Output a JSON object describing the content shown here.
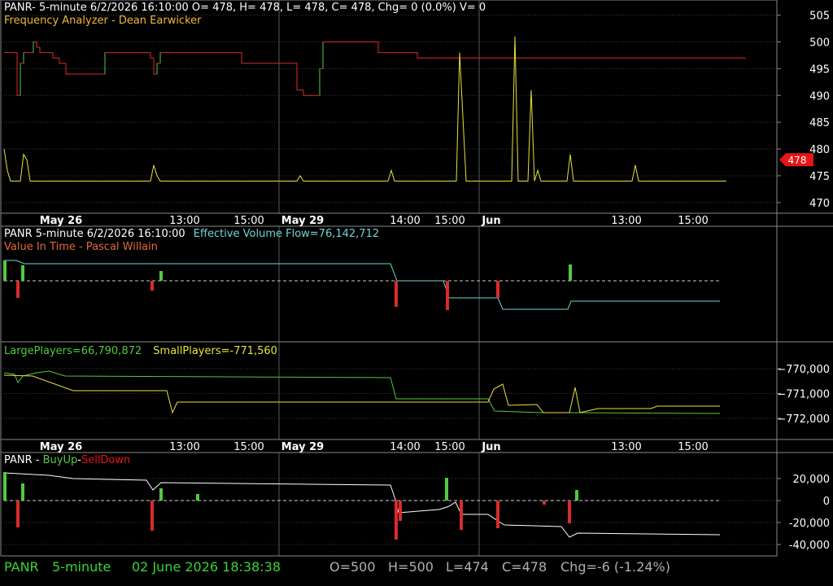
{
  "colors": {
    "bg": "#000000",
    "grid": "#3a3a3a",
    "axis": "#8a8a8a",
    "text": "#ffffff",
    "yellow": "#e7e23c",
    "orange": "#f2b83a",
    "red": "#d82b2b",
    "green": "#4fcb3f",
    "cyan": "#6fd6d6",
    "white": "#ffffff",
    "price_tag": "#e81515",
    "status_green": "#35d435",
    "status_gray": "#b0b0b0"
  },
  "panel1": {
    "title": "PANR- 5-minute 6/2/2026 16:10:00 O= 478, H= 478, L= 478, C= 478, Chg= 0 (0.0%) V= 0",
    "subtitle": "Frequency Analyzer - Dean Earwicker",
    "price_tag": "478"
  },
  "panel2": {
    "title": "PANR 5-minute  6/2/2026 16:10:00",
    "subtitle": "Effective Volume Flow=76,142,712",
    "line2": "Value In Time - Pascal Willain"
  },
  "panel3": {
    "large": "LargePlayers=66,790,872",
    "small": "SmallPlayers=-771,560"
  },
  "panel4": {
    "prefix": "PANR - ",
    "buy": "BuyUp",
    "sep": "-",
    "sell": "SellDown"
  },
  "status": {
    "symbol": "PANR",
    "interval": "5-minute",
    "datetime": "02 June 2026 18:38:38",
    "o": "O=500",
    "h": "H=500",
    "l": "L=474",
    "c": "C=478",
    "chg": "Chg=-6 (-1.24%)"
  },
  "chart_data": [
    {
      "type": "line",
      "panel": "price",
      "x_tick_labels": [
        "May 26",
        "13:00",
        "15:00",
        "May 29",
        "14:00",
        "15:00",
        "Jun",
        "13:00",
        "15:00"
      ],
      "y_ticks": [
        470,
        475,
        480,
        485,
        490,
        495,
        500,
        505
      ],
      "ylim": [
        468,
        506
      ],
      "last_value": 478,
      "x": [
        0,
        1,
        2,
        3,
        4,
        5,
        6,
        7,
        8,
        9,
        10,
        11,
        12,
        13,
        14,
        15,
        16,
        17,
        18,
        19,
        20,
        21,
        22,
        23,
        24,
        25,
        26,
        27,
        28,
        29,
        30,
        31,
        32,
        33,
        34,
        35,
        36,
        37,
        38,
        39,
        40,
        41,
        42,
        43,
        44,
        45,
        46,
        47,
        48,
        49,
        50,
        51,
        52,
        53,
        54,
        55,
        56,
        57,
        58,
        59,
        60,
        61,
        62,
        63,
        64,
        65,
        66,
        67,
        68,
        69,
        70,
        71,
        72,
        73,
        74,
        75,
        76,
        77,
        78,
        79,
        80,
        81,
        82,
        83,
        84,
        85,
        86,
        87,
        88,
        89,
        90,
        91,
        92,
        93,
        94,
        95,
        96,
        97,
        98,
        99,
        100,
        101,
        102,
        103,
        104,
        105,
        106,
        107,
        108,
        109,
        110,
        111,
        112,
        113,
        114,
        115,
        116,
        117,
        118,
        119,
        120,
        121,
        122,
        123,
        124,
        125,
        126,
        127,
        128,
        129,
        130,
        131,
        132,
        133,
        134,
        135,
        136,
        137,
        138,
        139,
        140,
        141,
        142,
        143,
        144,
        145,
        146,
        147,
        148,
        149,
        150,
        151,
        152,
        153,
        154,
        155,
        156,
        157,
        158,
        159,
        160,
        161,
        162,
        163,
        164,
        165,
        166,
        167,
        168,
        169,
        170,
        171,
        172,
        173,
        174,
        175,
        176,
        177,
        178,
        179,
        180,
        181,
        182,
        183,
        184,
        185,
        186,
        187,
        188,
        189,
        190,
        191,
        192,
        193,
        194,
        195,
        196,
        197,
        198,
        199,
        200,
        201,
        202,
        203,
        204,
        205,
        206,
        207,
        208,
        209,
        210,
        211,
        212,
        213,
        214,
        215,
        216,
        217,
        218,
        219,
        220
      ],
      "series": [
        {
          "color": "mixed-step",
          "values": [
            498,
            498,
            498,
            498,
            490,
            496,
            498,
            498,
            498,
            500,
            499,
            498,
            498,
            498,
            498,
            497,
            497,
            496,
            496,
            494,
            494,
            494,
            494,
            494,
            494,
            494,
            494,
            494,
            494,
            494,
            494,
            498,
            498,
            498,
            498,
            498,
            498,
            498,
            498,
            498,
            498,
            498,
            498,
            498,
            498,
            497,
            494,
            496,
            498,
            498,
            498,
            498,
            498,
            498,
            498,
            498,
            498,
            498,
            498,
            498,
            498,
            498,
            498,
            498,
            498,
            498,
            498,
            498,
            498,
            498,
            498,
            498,
            498,
            496,
            496,
            496,
            496,
            496,
            496,
            496,
            496,
            496,
            496,
            496,
            496,
            496,
            496,
            496,
            496,
            496,
            491,
            491,
            490,
            490,
            490,
            490,
            490,
            495,
            500,
            500,
            500,
            500,
            500,
            500,
            500,
            500,
            500,
            500,
            500,
            500,
            500,
            500,
            500,
            500,
            500,
            498,
            498,
            498,
            498,
            498,
            498,
            498,
            498,
            498,
            498,
            498,
            498,
            497,
            497,
            497,
            497,
            497,
            497,
            497,
            497,
            497,
            497,
            497,
            497,
            497,
            497,
            497,
            497,
            497,
            497,
            497,
            497,
            497,
            497,
            497,
            497,
            497,
            497,
            497,
            497,
            497,
            497,
            497,
            497,
            497,
            497,
            497,
            497,
            497,
            497,
            497,
            497,
            497,
            497,
            497,
            497,
            497,
            497,
            497,
            497,
            497,
            497,
            497,
            497,
            497,
            497,
            497,
            497,
            497,
            497,
            497,
            497,
            497,
            497,
            497,
            497,
            497,
            497,
            497,
            497,
            497,
            497,
            497,
            497,
            497,
            497,
            497,
            497,
            497,
            497,
            497,
            497,
            497,
            497,
            497,
            497,
            497,
            497,
            497,
            497,
            497,
            497,
            497,
            497,
            497,
            497,
            497,
            497,
            497,
            497,
            497,
            497,
            497,
            497
          ]
        },
        {
          "color": "yellow",
          "values": [
            480,
            476,
            474,
            474,
            474,
            474,
            479,
            478,
            474,
            474,
            474,
            474,
            474,
            474,
            474,
            474,
            474,
            474,
            474,
            474,
            474,
            474,
            474,
            474,
            474,
            474,
            474,
            474,
            474,
            474,
            474,
            474,
            474,
            474,
            474,
            474,
            474,
            474,
            474,
            474,
            474,
            474,
            474,
            474,
            474,
            474,
            477,
            475,
            474,
            474,
            474,
            474,
            474,
            474,
            474,
            474,
            474,
            474,
            474,
            474,
            474,
            474,
            474,
            474,
            474,
            474,
            474,
            474,
            474,
            474,
            474,
            474,
            474,
            474,
            474,
            474,
            474,
            474,
            474,
            474,
            474,
            474,
            474,
            474,
            474,
            474,
            474,
            474,
            474,
            474,
            474,
            475,
            474,
            474,
            474,
            474,
            474,
            474,
            474,
            474,
            474,
            474,
            474,
            474,
            474,
            474,
            474,
            474,
            474,
            474,
            474,
            474,
            474,
            474,
            474,
            474,
            474,
            474,
            474,
            476,
            474,
            474,
            474,
            474,
            474,
            474,
            474,
            474,
            474,
            474,
            474,
            474,
            474,
            474,
            474,
            474,
            474,
            474,
            474,
            474,
            498,
            486,
            474,
            474,
            474,
            474,
            474,
            474,
            474,
            474,
            474,
            474,
            474,
            474,
            474,
            474,
            474,
            501,
            474,
            474,
            474,
            474,
            491,
            474,
            476,
            474,
            474,
            474,
            474,
            474,
            474,
            474,
            474,
            474,
            479,
            474,
            474,
            474,
            474,
            474,
            474,
            474,
            474,
            474,
            474,
            474,
            474,
            474,
            474,
            474,
            474,
            474,
            474,
            474,
            477,
            474,
            474,
            474,
            474,
            474,
            474,
            474,
            474,
            474,
            474,
            474,
            474,
            474,
            474,
            474,
            474,
            474,
            474,
            474,
            474,
            474,
            474,
            474,
            474,
            474,
            474,
            474,
            474
          ]
        }
      ]
    },
    {
      "type": "line",
      "panel": "effective-volume-flow",
      "series": [
        {
          "name": "Effective Volume Flow",
          "color": "cyan"
        }
      ]
    },
    {
      "type": "line",
      "panel": "players",
      "y_ticks": [
        -770000,
        -771000,
        -772000
      ],
      "y_tick_labels": [
        "770,000",
        "771,000",
        "772,000"
      ],
      "series": [
        {
          "name": "LargePlayers",
          "color": "green",
          "last_value": "66,790,872"
        },
        {
          "name": "SmallPlayers",
          "color": "yellow",
          "last_value": "-771,560"
        }
      ]
    },
    {
      "type": "bar",
      "panel": "buyup-selldown",
      "y_ticks": [
        20000,
        0,
        -20000,
        -40000
      ],
      "y_tick_labels": [
        "20,000",
        "0",
        "-20,000",
        "-40,000"
      ],
      "series": [
        {
          "name": "BuyUp",
          "color": "green"
        },
        {
          "name": "SellDown",
          "color": "red"
        }
      ]
    }
  ]
}
